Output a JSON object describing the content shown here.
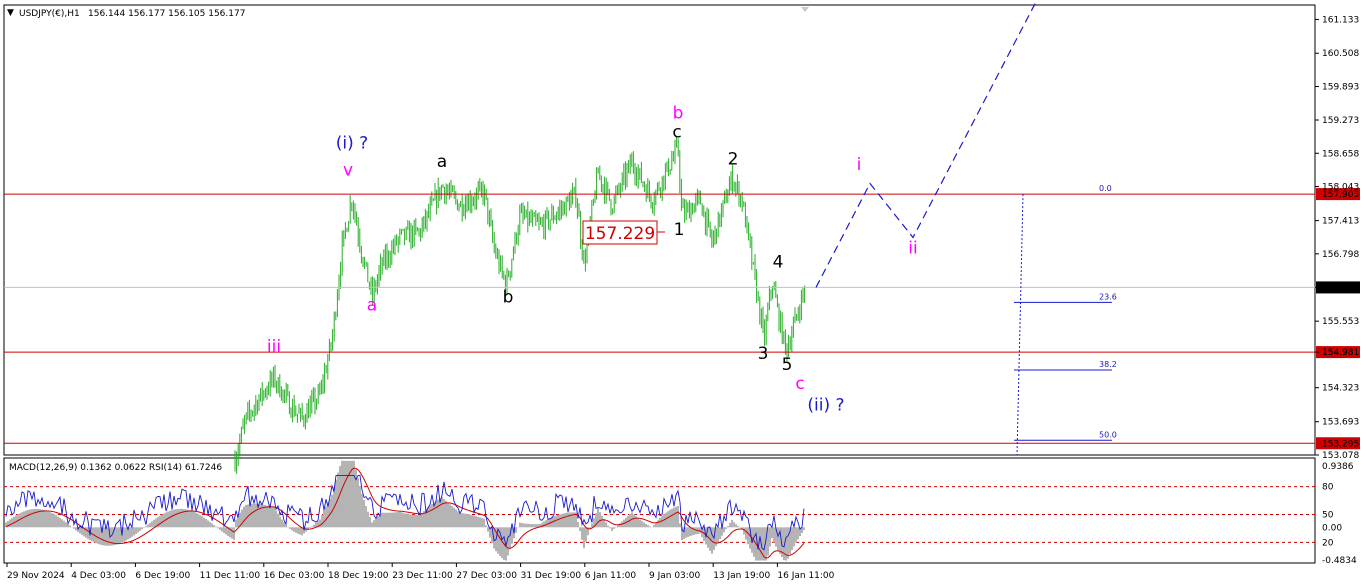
{
  "header": {
    "symbol": "USDJPY(€),H1",
    "ohlc": "156.144 156.177 156.105 156.177"
  },
  "indicator": {
    "title": "MACD(12,26,9) 0.1362 0.0622  RSI(14) 61.7246"
  },
  "price_box": {
    "text": "157.229"
  },
  "colors": {
    "candle": "#27ae27",
    "sr_line": "#d00000",
    "wave_black": "#000000",
    "wave_magenta": "#ff00ff",
    "wave_blue": "#1a1acc",
    "projection": "#1a1acc",
    "macd_hist": "#b4b4b4",
    "macd_line": "#1a1acc",
    "signal_line": "#d00000"
  },
  "chart_data": {
    "type": "candlestick",
    "y_range": [
      153.078,
      161.4
    ],
    "y_ticks": [
      "161.133",
      "160.508",
      "159.893",
      "159.273",
      "158.658",
      "158.043",
      "157.413",
      "156.798",
      "156.177",
      "155.553",
      "154.981",
      "154.323",
      "153.693",
      "153.078"
    ],
    "x_ticks": [
      "29 Nov 2024",
      "4 Dec 03:00",
      "6 Dec 19:00",
      "11 Dec 11:00",
      "16 Dec 03:00",
      "18 Dec 19:00",
      "23 Dec 11:00",
      "27 Dec 03:00",
      "31 Dec 19:00",
      "6 Jan 11:00",
      "9 Jan 03:00",
      "13 Jan 19:00",
      "16 Jan 11:00"
    ],
    "price_path": [
      {
        "t": 235,
        "v": 153.0
      },
      {
        "t": 245,
        "v": 153.7
      },
      {
        "t": 258,
        "v": 154.1
      },
      {
        "t": 274,
        "v": 154.5
      },
      {
        "t": 290,
        "v": 154.0
      },
      {
        "t": 302,
        "v": 153.75
      },
      {
        "t": 320,
        "v": 154.2
      },
      {
        "t": 332,
        "v": 155.2
      },
      {
        "t": 342,
        "v": 156.9
      },
      {
        "t": 352,
        "v": 157.85
      },
      {
        "t": 362,
        "v": 156.8
      },
      {
        "t": 372,
        "v": 156.0
      },
      {
        "t": 382,
        "v": 156.6
      },
      {
        "t": 400,
        "v": 157.1
      },
      {
        "t": 420,
        "v": 157.2
      },
      {
        "t": 442,
        "v": 158.05
      },
      {
        "t": 460,
        "v": 157.7
      },
      {
        "t": 484,
        "v": 157.95
      },
      {
        "t": 494,
        "v": 156.9
      },
      {
        "t": 506,
        "v": 156.2
      },
      {
        "t": 520,
        "v": 157.5
      },
      {
        "t": 540,
        "v": 157.3
      },
      {
        "t": 560,
        "v": 157.6
      },
      {
        "t": 576,
        "v": 157.9
      },
      {
        "t": 584,
        "v": 156.6
      },
      {
        "t": 598,
        "v": 158.3
      },
      {
        "t": 612,
        "v": 157.7
      },
      {
        "t": 632,
        "v": 158.5
      },
      {
        "t": 652,
        "v": 157.8
      },
      {
        "t": 678,
        "v": 158.75
      },
      {
        "t": 682,
        "v": 157.5
      },
      {
        "t": 700,
        "v": 157.8
      },
      {
        "t": 712,
        "v": 157.0
      },
      {
        "t": 732,
        "v": 158.2
      },
      {
        "t": 742,
        "v": 157.8
      },
      {
        "t": 755,
        "v": 156.3
      },
      {
        "t": 764,
        "v": 155.2
      },
      {
        "t": 772,
        "v": 156.3
      },
      {
        "t": 778,
        "v": 155.7
      },
      {
        "t": 786,
        "v": 155.0
      },
      {
        "t": 796,
        "v": 155.6
      },
      {
        "t": 805,
        "v": 156.177
      }
    ],
    "sr_levels": [
      157.903,
      154.981,
      153.295
    ],
    "sr_labels": [
      "157.903",
      "154.981",
      "153.295"
    ],
    "current_price": 156.177,
    "current_price_label": "156.177",
    "price_box_value": 157.229,
    "fib_levels": [
      {
        "label": "0.0",
        "v": 157.903
      },
      {
        "label": "23.6",
        "v": 155.9
      },
      {
        "label": "38.2",
        "v": 154.65
      },
      {
        "label": "50.0",
        "v": 153.35
      }
    ],
    "projection": [
      {
        "t": 816,
        "v": 156.177
      },
      {
        "t": 870,
        "v": 158.1
      },
      {
        "t": 913,
        "v": 157.1
      },
      {
        "t": 1040,
        "v": 161.6
      }
    ],
    "wave_labels": [
      {
        "text": "(i) ?",
        "t": 352,
        "v": 158.75,
        "color": "blue"
      },
      {
        "text": "v",
        "t": 348,
        "v": 158.25,
        "color": "magenta"
      },
      {
        "text": "iii",
        "t": 274,
        "v": 154.98,
        "color": "magenta"
      },
      {
        "text": "a",
        "t": 372,
        "v": 155.75,
        "color": "magenta"
      },
      {
        "text": "a",
        "t": 442,
        "v": 158.4,
        "color": "black"
      },
      {
        "text": "b",
        "t": 508,
        "v": 155.9,
        "color": "black"
      },
      {
        "text": "b",
        "t": 678,
        "v": 159.3,
        "color": "magenta"
      },
      {
        "text": "c",
        "t": 677,
        "v": 158.95,
        "color": "black"
      },
      {
        "text": "1",
        "t": 679,
        "v": 157.15,
        "color": "black"
      },
      {
        "text": "2",
        "t": 733,
        "v": 158.45,
        "color": "black"
      },
      {
        "text": "3",
        "t": 763,
        "v": 154.85,
        "color": "black"
      },
      {
        "text": "4",
        "t": 778,
        "v": 156.55,
        "color": "black"
      },
      {
        "text": "5",
        "t": 787,
        "v": 154.65,
        "color": "black"
      },
      {
        "text": "c",
        "t": 800,
        "v": 154.3,
        "color": "magenta"
      },
      {
        "text": "(ii) ?",
        "t": 826,
        "v": 153.9,
        "color": "blue"
      },
      {
        "text": "i",
        "t": 859,
        "v": 158.35,
        "color": "magenta"
      },
      {
        "text": "ii",
        "t": 913,
        "v": 156.8,
        "color": "magenta"
      }
    ],
    "indicator_ticks": [
      "0.9386",
      "80",
      "50",
      "0.00",
      "20",
      "-0.4834"
    ],
    "indicator_range": [
      -0.4834,
      0.9386
    ],
    "rsi_levels": [
      80,
      50,
      20
    ]
  }
}
